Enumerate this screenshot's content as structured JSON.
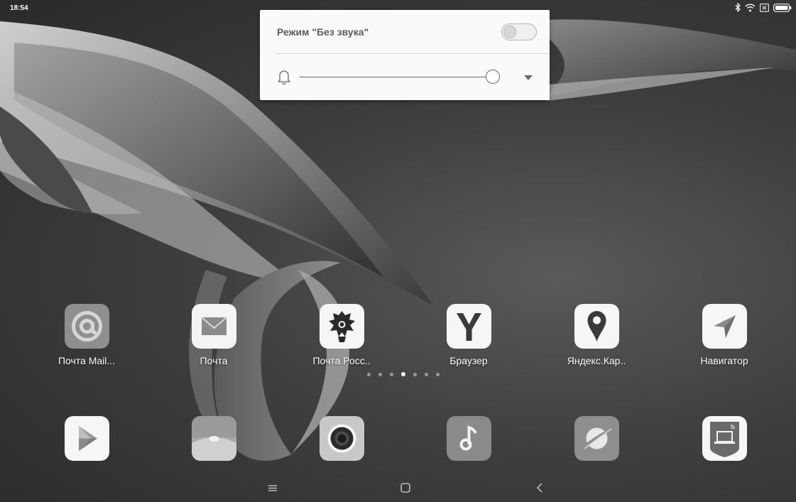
{
  "status_bar": {
    "time": "18:54",
    "icons": [
      "bluetooth-icon",
      "wifi-icon",
      "no-sim-icon",
      "battery-icon"
    ]
  },
  "volume_panel": {
    "silent_mode_label": "Режим \"Без звука\"",
    "silent_mode_enabled": false,
    "volume_level": 0.95,
    "ringer_icon": "bell-icon",
    "expand_icon": "chevron-down-icon"
  },
  "apps_row1": [
    {
      "label": "Почта Mail...",
      "icon": "mail-ru-icon"
    },
    {
      "label": "Почта",
      "icon": "envelope-icon"
    },
    {
      "label": "Почта Росс..",
      "icon": "russian-post-icon"
    },
    {
      "label": "Браузер",
      "icon": "yandex-browser-icon"
    },
    {
      "label": "Яндекс.Кар..",
      "icon": "map-pin-icon"
    },
    {
      "label": "Навигатор",
      "icon": "navigator-arrow-icon"
    }
  ],
  "dock": [
    {
      "icon": "play-store-icon"
    },
    {
      "icon": "gallery-icon"
    },
    {
      "icon": "camera-icon"
    },
    {
      "icon": "music-icon"
    },
    {
      "icon": "browser-planet-icon"
    },
    {
      "icon": "gosuslugi-icon"
    }
  ],
  "page_indicator": {
    "count": 7,
    "active_index": 3
  },
  "nav_bar": {
    "buttons": [
      "menu-icon",
      "home-icon",
      "back-icon"
    ]
  }
}
